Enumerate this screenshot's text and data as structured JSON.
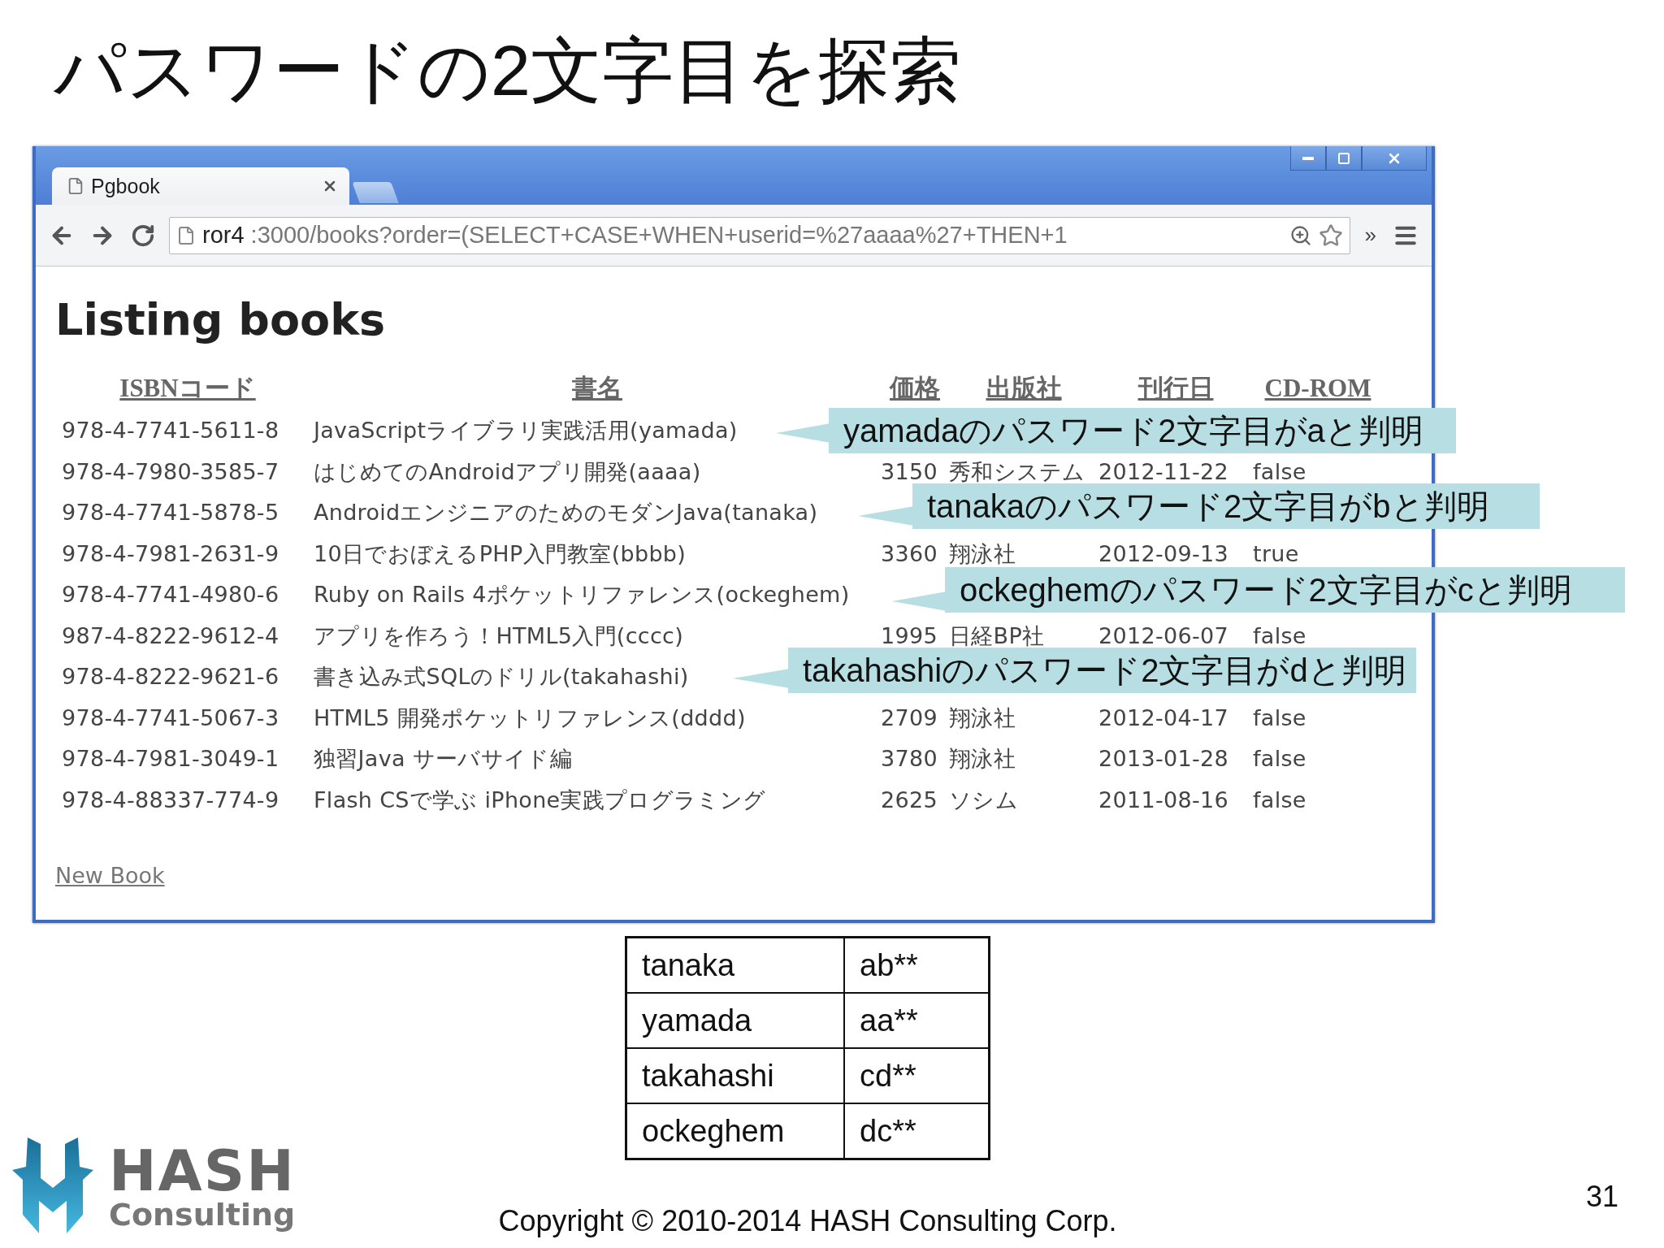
{
  "slide_title": "パスワードの2文字目を探索",
  "browser": {
    "tab_title": "Pgbook",
    "address": {
      "host": "ror4",
      "rest": ":3000/books?order=(SELECT+CASE+WHEN+userid=%27aaaa%27+THEN+1"
    },
    "overflow": "»",
    "page": {
      "heading": "Listing books",
      "columns": [
        "ISBNコード",
        "書名",
        "価格",
        "出版社",
        "刊行日",
        "CD-ROM"
      ],
      "rows": [
        {
          "cells": [
            "978-4-7741-5611-8",
            "JavaScriptライブラリ実践活用(yamada)"
          ]
        },
        {
          "cells": [
            "978-4-7980-3585-7",
            "はじめてのAndroidアプリ開発(aaaa)",
            "3150",
            "秀和システム",
            "2012-11-22",
            "false"
          ]
        },
        {
          "cells": [
            "978-4-7741-5878-5",
            "AndroidエンジニアのためのモダンJava(tanaka)"
          ]
        },
        {
          "cells": [
            "978-4-7981-2631-9",
            "10日でおぼえるPHP入門教室(bbbb)",
            "3360",
            "翔泳社",
            "2012-09-13",
            "true"
          ]
        },
        {
          "cells": [
            "978-4-7741-4980-6",
            "Ruby on Rails 4ポケットリファレンス(ockeghem)"
          ]
        },
        {
          "cells": [
            "987-4-8222-9612-4",
            "アプリを作ろう！HTML5入門(cccc)",
            "1995",
            "日経BP社",
            "2012-06-07",
            "false"
          ]
        },
        {
          "cells": [
            "978-4-8222-9621-6",
            "書き込み式SQLのドリル(takahashi)"
          ]
        },
        {
          "cells": [
            "978-4-7741-5067-3",
            "HTML5 開発ポケットリファレンス(dddd)",
            "2709",
            "翔泳社",
            "2012-04-17",
            "false"
          ]
        },
        {
          "cells": [
            "978-4-7981-3049-1",
            "独習Java サーバサイド編",
            "3780",
            "翔泳社",
            "2013-01-28",
            "false"
          ]
        },
        {
          "cells": [
            "978-4-88337-774-9",
            "Flash CSで学ぶ iPhone実践プログラミング",
            "2625",
            "ソシム",
            "2011-08-16",
            "false"
          ]
        }
      ],
      "link": "New Book"
    }
  },
  "callouts": [
    {
      "text": "yamadaのパスワード2文字目がaと判明"
    },
    {
      "text": "tanakaのパスワード2文字目がbと判明"
    },
    {
      "text": "ockeghemのパスワード2文字目がcと判明"
    },
    {
      "text": "takahashiのパスワード2文字目がdと判明"
    }
  ],
  "password_table": [
    {
      "user": "tanaka",
      "password": "ab**"
    },
    {
      "user": "yamada",
      "password": "aa**"
    },
    {
      "user": "takahashi",
      "password": "cd**"
    },
    {
      "user": "ockeghem",
      "password": "dc**"
    }
  ],
  "footer": {
    "logo_top": "HASH",
    "logo_bottom": "Consulting",
    "copyright": "Copyright © 2010-2014 HASH Consulting Corp.",
    "page_number": "31"
  }
}
